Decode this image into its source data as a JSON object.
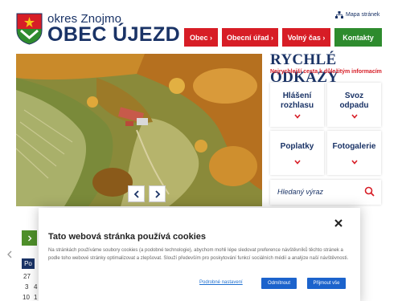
{
  "header": {
    "district": "okres Znojmo",
    "village": "OBEC ÚJEZD",
    "sitemap_label": "Mapa stránek"
  },
  "nav": [
    {
      "label": "Obec ›"
    },
    {
      "label": "Obecní úřad ›"
    },
    {
      "label": "Volný čas ›"
    },
    {
      "label": "Kontakty"
    }
  ],
  "quick_links": {
    "title": "RYCHLÉ ODKAZY",
    "subtitle": "Nejrychlejší cesta k důležitým informacím",
    "tiles": [
      {
        "line1": "Hlášení",
        "line2": "rozhlasu"
      },
      {
        "line1": "Svoz",
        "line2": "odpadu"
      },
      {
        "line1": "Poplatky",
        "line2": ""
      },
      {
        "line1": "Fotogalerie",
        "line2": ""
      }
    ],
    "search_placeholder": "Hledaný výraz"
  },
  "calendar": {
    "day_header": "Po",
    "days": [
      "27",
      "3",
      "4",
      "10",
      "1"
    ]
  },
  "cookie": {
    "title": "Tato webová stránka používá cookies",
    "text": "Na stránkách používáme soubory cookies (a podobné technologie), abychom mohli lépe sledovat preference návštěvníků těchto stránek a podle toho webové stránky optimalizovat a zlepšovat. Slouží především pro poskytování funkcí sociálních médií a analýze naší návštěvnosti.",
    "settings_label": "Podrobné nastavení",
    "reject_label": "Odmítnout",
    "accept_label": "Přijmout vše"
  },
  "colors": {
    "brand_blue": "#1a3366",
    "nav_red": "#d71d26",
    "nav_green": "#2e8b2e",
    "button_blue": "#1c63cc"
  }
}
